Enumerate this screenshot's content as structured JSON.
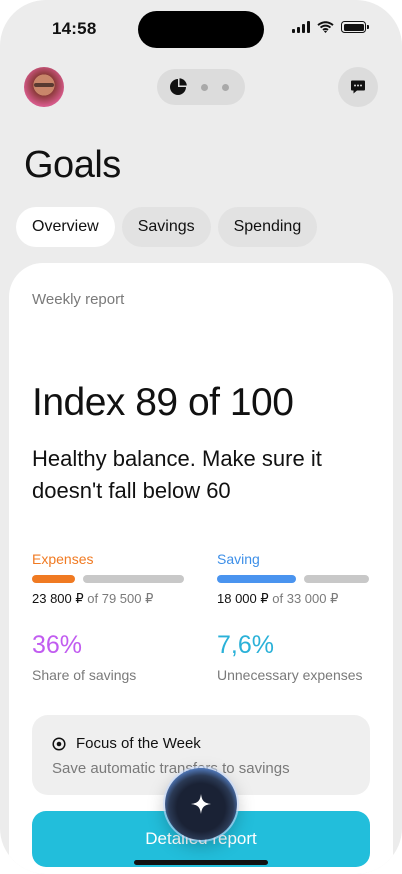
{
  "status_bar": {
    "time": "14:58"
  },
  "header": {
    "avatar_icon": "user-avatar",
    "pager_icon": "pie-chart-icon",
    "chat_icon": "chat-bubble-icon"
  },
  "page": {
    "title": "Goals"
  },
  "tabs": [
    {
      "label": "Overview",
      "active": true
    },
    {
      "label": "Savings",
      "active": false
    },
    {
      "label": "Spending",
      "active": false
    }
  ],
  "report": {
    "heading": "Weekly report",
    "index_text": "Index 89 of 100",
    "message": "Healthy balance. Make sure it doesn't fall below 60",
    "expenses": {
      "label": "Expenses",
      "current": "23 800 ₽",
      "of_text": "of 79 500 ₽",
      "progress": 0.3,
      "color": "#f07a22"
    },
    "saving": {
      "label": "Saving",
      "current": "18 000 ₽",
      "of_text": "of 33 000 ₽",
      "progress": 0.55,
      "color": "#4a94ef"
    },
    "share_of_savings": {
      "value": "36%",
      "label": "Share of savings",
      "color": "#c15cf0"
    },
    "unnecessary_expenses": {
      "value": "7,6%",
      "label": "Unnecessary expenses",
      "color": "#2ab1d8"
    },
    "focus": {
      "icon": "target-icon",
      "title": "Focus of the Week",
      "text": "Save automatic transfers to savings"
    },
    "cta_label": "Detailed report"
  },
  "ai_button": {
    "icon": "sparkle-icon"
  }
}
